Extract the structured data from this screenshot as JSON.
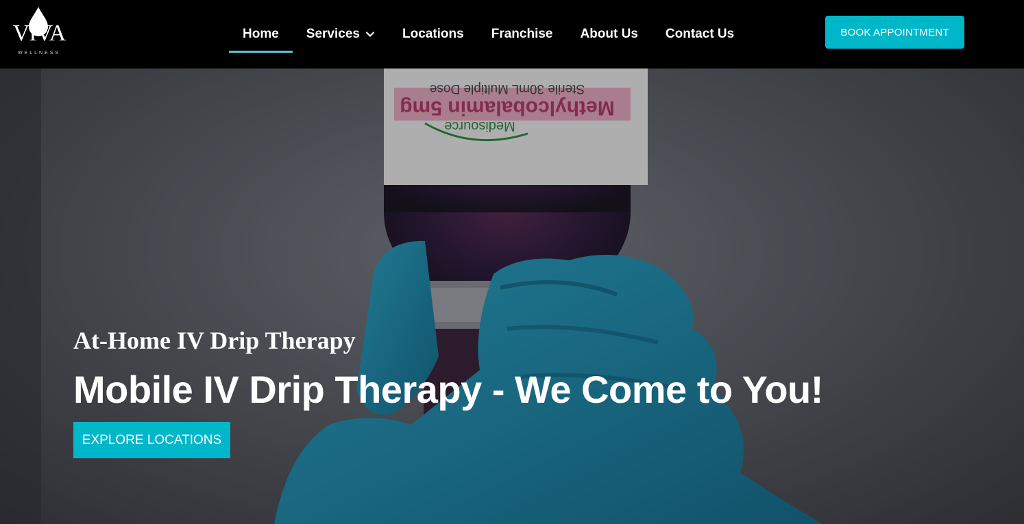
{
  "brand": {
    "name": "VIVA",
    "tagline": "WELLNESS"
  },
  "nav": {
    "items": [
      {
        "label": "Home",
        "active": true
      },
      {
        "label": "Services",
        "has_dropdown": true
      },
      {
        "label": "Locations"
      },
      {
        "label": "Franchise"
      },
      {
        "label": "About Us"
      },
      {
        "label": "Contact Us"
      }
    ],
    "cta_label": "BOOK APPOINTMENT"
  },
  "hero": {
    "subtitle": "At-Home IV Drip Therapy",
    "title": "Mobile IV Drip Therapy - We Come to You!",
    "cta_label": "EXPLORE LOCATIONS",
    "vial_label": {
      "line1": "Methylcobalamin 5mg",
      "line2": "Sterile 30mL Multiple Dose",
      "brand": "Medisource"
    }
  },
  "colors": {
    "accent": "#00b7c9",
    "nav_underline": "#5bc4d4",
    "nav_bg": "#000000",
    "glove": "#1f8fb0"
  },
  "icons": {
    "logo_drop": "water-drop-icon",
    "services_dropdown": "chevron-down-icon"
  }
}
